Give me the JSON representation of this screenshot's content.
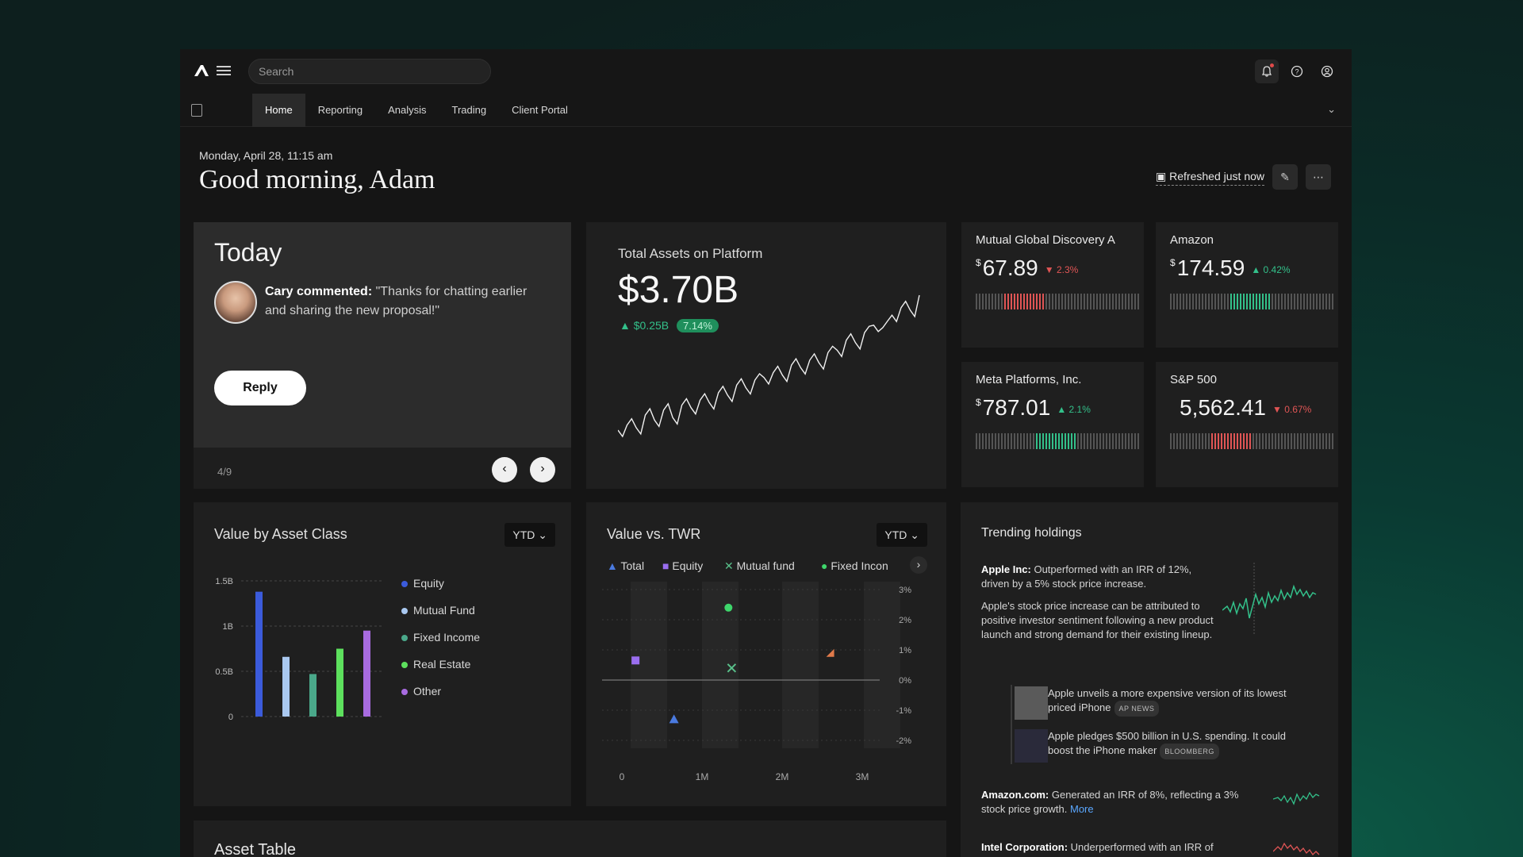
{
  "topbar": {
    "search_placeholder": "Search"
  },
  "nav": {
    "tabs": [
      "Home",
      "Reporting",
      "Analysis",
      "Trading",
      "Client Portal"
    ],
    "active": "Home"
  },
  "header": {
    "date": "Monday, April 28, 11:15 am",
    "greeting": "Good morning, Adam",
    "refresh": "Refreshed just now"
  },
  "today": {
    "title": "Today",
    "commenter": "Cary commented:",
    "comment": "\"Thanks for chatting earlier and sharing the new proposal!\"",
    "reply": "Reply",
    "pager": "4/9"
  },
  "assets": {
    "title": "Total Assets on Platform",
    "value": "$3.70B",
    "change": "$0.25B",
    "change_pct": "7.14%"
  },
  "stocks": [
    {
      "name": "Mutual Global Discovery A",
      "currency": "$",
      "price": "67.89",
      "delta": "2.3%",
      "direction": "down",
      "level": 0.42
    },
    {
      "name": "Amazon",
      "currency": "$",
      "price": "174.59",
      "delta": "0.42%",
      "direction": "up",
      "level": 0.62
    },
    {
      "name": "Meta Platforms, Inc.",
      "currency": "$",
      "price": "787.01",
      "delta": "2.1%",
      "direction": "up",
      "level": 0.62
    },
    {
      "name": "S&P 500",
      "currency": "",
      "price": "5,562.41",
      "delta": "0.67%",
      "direction": "down",
      "level": 0.5
    }
  ],
  "colors": {
    "up": "#33c08a",
    "down": "#e05555",
    "neutral": "#555555"
  },
  "vac": {
    "title": "Value by Asset Class",
    "period": "YTD",
    "legend": [
      {
        "name": "Equity",
        "color": "#3b5bdb"
      },
      {
        "name": "Mutual Fund",
        "color": "#a9c8f0"
      },
      {
        "name": "Fixed Income",
        "color": "#4aa88a"
      },
      {
        "name": "Real Estate",
        "color": "#5de05d"
      },
      {
        "name": "Other",
        "color": "#a86be0"
      }
    ]
  },
  "vtwr": {
    "title": "Value vs. TWR",
    "period": "YTD",
    "legend": [
      {
        "name": "Total",
        "color": "#4a7ae0",
        "marker": "▲"
      },
      {
        "name": "Equity",
        "color": "#9a6ef0",
        "marker": "■"
      },
      {
        "name": "Mutual fund",
        "color": "#59c08a",
        "marker": "✕"
      },
      {
        "name": "Fixed Incon",
        "color": "#3ed66b",
        "marker": "●"
      }
    ]
  },
  "trending": {
    "title": "Trending holdings",
    "items": [
      {
        "company": "Apple Inc:",
        "text": "Outperformed with an IRR of 12%, driven by a 5% stock price increase."
      },
      {
        "company": "Amazon.com:",
        "text": "Generated an IRR of 8%, reflecting a 3% stock price growth.",
        "more": "More"
      },
      {
        "company": "Intel Corporation:",
        "text": "Underperformed with an IRR of"
      }
    ],
    "detail": "Apple's stock price increase can be attributed to positive investor sentiment following a new product launch and strong demand for their existing lineup.",
    "news": [
      {
        "headline": "Apple unveils a more expensive version of its lowest priced iPhone",
        "source": "AP NEWS"
      },
      {
        "headline": "Apple pledges $500 billion in U.S. spending. It could boost the iPhone maker",
        "source": "BLOOMBERG"
      }
    ]
  },
  "asset_table": {
    "title": "Asset Table"
  },
  "chart_data": [
    {
      "type": "bar",
      "categories": [
        "Equity",
        "Mutual Fund",
        "Fixed Income",
        "Real Estate",
        "Other"
      ],
      "values": [
        1.38,
        0.66,
        0.47,
        0.75,
        0.95
      ],
      "ylim": [
        0,
        1.5
      ],
      "yticks": [
        "0",
        "0.5B",
        "1B",
        "1.5B"
      ],
      "grid": true
    },
    {
      "type": "scatter",
      "x_ticks": [
        "0",
        "1M",
        "2M",
        "3M"
      ],
      "y_ticks": [
        "3%",
        "2%",
        "1%",
        "0%",
        "-1%",
        "-2%"
      ],
      "ylim": [
        -2,
        3
      ],
      "series": [
        {
          "name": "Total",
          "x": [
            0.65
          ],
          "y": [
            -1.3
          ]
        },
        {
          "name": "Equity",
          "x": [
            0.17
          ],
          "y": [
            0.65
          ]
        },
        {
          "name": "Mutual fund",
          "x": [
            1.37
          ],
          "y": [
            0.4
          ]
        },
        {
          "name": "Fixed Incon",
          "x": [
            1.33
          ],
          "y": [
            2.4
          ]
        },
        {
          "name": "",
          "x": [
            2.6
          ],
          "y": [
            0.9
          ]
        }
      ]
    },
    {
      "type": "line",
      "values": [
        1.0,
        1.1,
        1.05,
        1.3,
        1.2,
        1.4,
        1.25,
        1.5,
        1.45,
        1.6,
        1.55,
        1.75,
        1.7,
        1.9,
        1.85,
        2.0,
        2.05,
        2.15,
        2.1,
        2.3,
        2.25,
        2.4,
        2.35,
        2.55,
        2.6,
        2.8,
        2.75,
        2.95,
        3.1,
        3.05,
        3.3,
        3.45,
        3.4,
        3.7
      ]
    }
  ]
}
